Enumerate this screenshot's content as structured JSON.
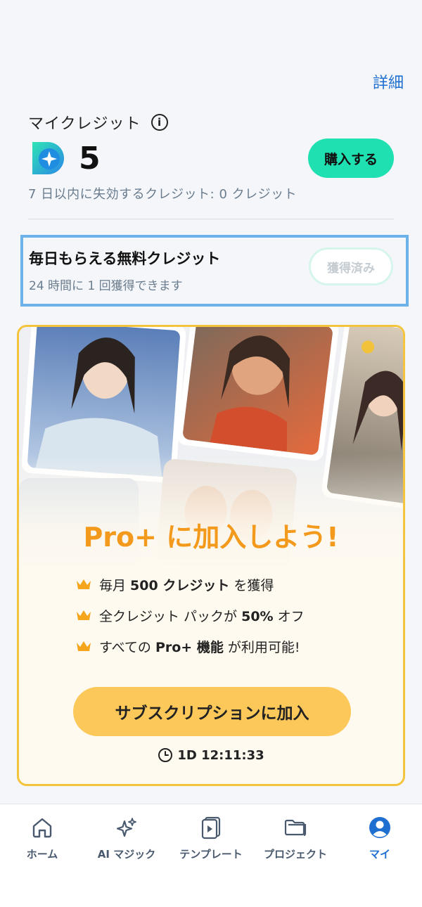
{
  "header": {
    "detail_link": "詳細"
  },
  "credits": {
    "title": "マイクレジット",
    "value": "5",
    "buy_label": "購入する",
    "expire_text": "7 日以内に失効するクレジット:  0 クレジット"
  },
  "daily": {
    "title": "毎日もらえる無料クレジット",
    "subtitle": "24 時間に 1 回獲得できます",
    "claimed_label": "獲得済み"
  },
  "promo": {
    "title": "Pro+ に加入しよう!",
    "features": [
      {
        "pre": "毎月 ",
        "bold": "500 クレジット",
        "post": " を獲得"
      },
      {
        "pre": "全クレジット パックが ",
        "bold": "50%",
        "post": " オフ"
      },
      {
        "pre": "すべての ",
        "bold": "Pro+ 機能",
        "post": " が利用可能!"
      }
    ],
    "subscribe_label": "サブスクリプションに加入",
    "timer": "1D 12:11:33"
  },
  "nav": {
    "items": [
      {
        "label": "ホーム",
        "icon": "home-icon"
      },
      {
        "label": "AI マジック",
        "icon": "sparkle-icon"
      },
      {
        "label": "テンプレート",
        "icon": "template-icon"
      },
      {
        "label": "プロジェクト",
        "icon": "folder-icon"
      },
      {
        "label": "マイ",
        "icon": "profile-icon",
        "active": true
      }
    ]
  },
  "colors": {
    "accent_teal": "#1fe0b0",
    "link_blue": "#1e6fd0",
    "promo_orange": "#f39a1c",
    "promo_button": "#fcc85a",
    "promo_border": "#f4c53c"
  }
}
